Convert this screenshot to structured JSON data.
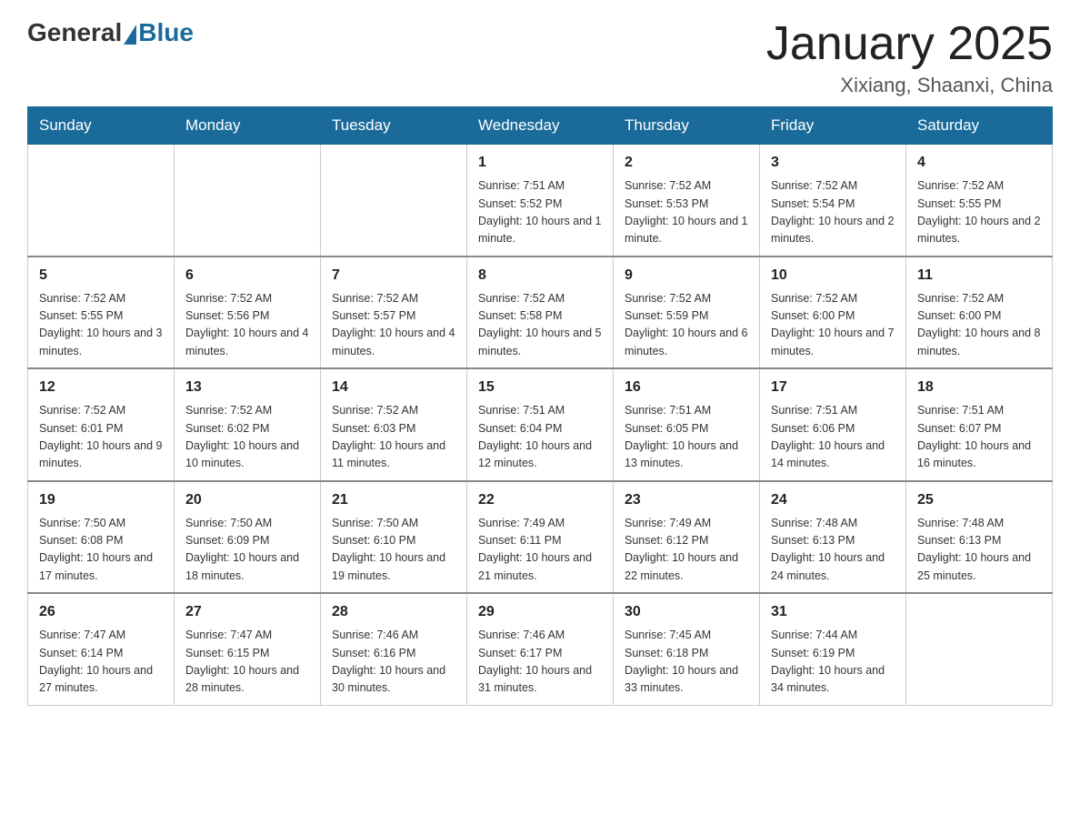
{
  "header": {
    "logo_general": "General",
    "logo_blue": "Blue",
    "title": "January 2025",
    "subtitle": "Xixiang, Shaanxi, China"
  },
  "weekdays": [
    "Sunday",
    "Monday",
    "Tuesday",
    "Wednesday",
    "Thursday",
    "Friday",
    "Saturday"
  ],
  "weeks": [
    [
      {
        "day": "",
        "sunrise": "",
        "sunset": "",
        "daylight": ""
      },
      {
        "day": "",
        "sunrise": "",
        "sunset": "",
        "daylight": ""
      },
      {
        "day": "",
        "sunrise": "",
        "sunset": "",
        "daylight": ""
      },
      {
        "day": "1",
        "sunrise": "Sunrise: 7:51 AM",
        "sunset": "Sunset: 5:52 PM",
        "daylight": "Daylight: 10 hours and 1 minute."
      },
      {
        "day": "2",
        "sunrise": "Sunrise: 7:52 AM",
        "sunset": "Sunset: 5:53 PM",
        "daylight": "Daylight: 10 hours and 1 minute."
      },
      {
        "day": "3",
        "sunrise": "Sunrise: 7:52 AM",
        "sunset": "Sunset: 5:54 PM",
        "daylight": "Daylight: 10 hours and 2 minutes."
      },
      {
        "day": "4",
        "sunrise": "Sunrise: 7:52 AM",
        "sunset": "Sunset: 5:55 PM",
        "daylight": "Daylight: 10 hours and 2 minutes."
      }
    ],
    [
      {
        "day": "5",
        "sunrise": "Sunrise: 7:52 AM",
        "sunset": "Sunset: 5:55 PM",
        "daylight": "Daylight: 10 hours and 3 minutes."
      },
      {
        "day": "6",
        "sunrise": "Sunrise: 7:52 AM",
        "sunset": "Sunset: 5:56 PM",
        "daylight": "Daylight: 10 hours and 4 minutes."
      },
      {
        "day": "7",
        "sunrise": "Sunrise: 7:52 AM",
        "sunset": "Sunset: 5:57 PM",
        "daylight": "Daylight: 10 hours and 4 minutes."
      },
      {
        "day": "8",
        "sunrise": "Sunrise: 7:52 AM",
        "sunset": "Sunset: 5:58 PM",
        "daylight": "Daylight: 10 hours and 5 minutes."
      },
      {
        "day": "9",
        "sunrise": "Sunrise: 7:52 AM",
        "sunset": "Sunset: 5:59 PM",
        "daylight": "Daylight: 10 hours and 6 minutes."
      },
      {
        "day": "10",
        "sunrise": "Sunrise: 7:52 AM",
        "sunset": "Sunset: 6:00 PM",
        "daylight": "Daylight: 10 hours and 7 minutes."
      },
      {
        "day": "11",
        "sunrise": "Sunrise: 7:52 AM",
        "sunset": "Sunset: 6:00 PM",
        "daylight": "Daylight: 10 hours and 8 minutes."
      }
    ],
    [
      {
        "day": "12",
        "sunrise": "Sunrise: 7:52 AM",
        "sunset": "Sunset: 6:01 PM",
        "daylight": "Daylight: 10 hours and 9 minutes."
      },
      {
        "day": "13",
        "sunrise": "Sunrise: 7:52 AM",
        "sunset": "Sunset: 6:02 PM",
        "daylight": "Daylight: 10 hours and 10 minutes."
      },
      {
        "day": "14",
        "sunrise": "Sunrise: 7:52 AM",
        "sunset": "Sunset: 6:03 PM",
        "daylight": "Daylight: 10 hours and 11 minutes."
      },
      {
        "day": "15",
        "sunrise": "Sunrise: 7:51 AM",
        "sunset": "Sunset: 6:04 PM",
        "daylight": "Daylight: 10 hours and 12 minutes."
      },
      {
        "day": "16",
        "sunrise": "Sunrise: 7:51 AM",
        "sunset": "Sunset: 6:05 PM",
        "daylight": "Daylight: 10 hours and 13 minutes."
      },
      {
        "day": "17",
        "sunrise": "Sunrise: 7:51 AM",
        "sunset": "Sunset: 6:06 PM",
        "daylight": "Daylight: 10 hours and 14 minutes."
      },
      {
        "day": "18",
        "sunrise": "Sunrise: 7:51 AM",
        "sunset": "Sunset: 6:07 PM",
        "daylight": "Daylight: 10 hours and 16 minutes."
      }
    ],
    [
      {
        "day": "19",
        "sunrise": "Sunrise: 7:50 AM",
        "sunset": "Sunset: 6:08 PM",
        "daylight": "Daylight: 10 hours and 17 minutes."
      },
      {
        "day": "20",
        "sunrise": "Sunrise: 7:50 AM",
        "sunset": "Sunset: 6:09 PM",
        "daylight": "Daylight: 10 hours and 18 minutes."
      },
      {
        "day": "21",
        "sunrise": "Sunrise: 7:50 AM",
        "sunset": "Sunset: 6:10 PM",
        "daylight": "Daylight: 10 hours and 19 minutes."
      },
      {
        "day": "22",
        "sunrise": "Sunrise: 7:49 AM",
        "sunset": "Sunset: 6:11 PM",
        "daylight": "Daylight: 10 hours and 21 minutes."
      },
      {
        "day": "23",
        "sunrise": "Sunrise: 7:49 AM",
        "sunset": "Sunset: 6:12 PM",
        "daylight": "Daylight: 10 hours and 22 minutes."
      },
      {
        "day": "24",
        "sunrise": "Sunrise: 7:48 AM",
        "sunset": "Sunset: 6:13 PM",
        "daylight": "Daylight: 10 hours and 24 minutes."
      },
      {
        "day": "25",
        "sunrise": "Sunrise: 7:48 AM",
        "sunset": "Sunset: 6:13 PM",
        "daylight": "Daylight: 10 hours and 25 minutes."
      }
    ],
    [
      {
        "day": "26",
        "sunrise": "Sunrise: 7:47 AM",
        "sunset": "Sunset: 6:14 PM",
        "daylight": "Daylight: 10 hours and 27 minutes."
      },
      {
        "day": "27",
        "sunrise": "Sunrise: 7:47 AM",
        "sunset": "Sunset: 6:15 PM",
        "daylight": "Daylight: 10 hours and 28 minutes."
      },
      {
        "day": "28",
        "sunrise": "Sunrise: 7:46 AM",
        "sunset": "Sunset: 6:16 PM",
        "daylight": "Daylight: 10 hours and 30 minutes."
      },
      {
        "day": "29",
        "sunrise": "Sunrise: 7:46 AM",
        "sunset": "Sunset: 6:17 PM",
        "daylight": "Daylight: 10 hours and 31 minutes."
      },
      {
        "day": "30",
        "sunrise": "Sunrise: 7:45 AM",
        "sunset": "Sunset: 6:18 PM",
        "daylight": "Daylight: 10 hours and 33 minutes."
      },
      {
        "day": "31",
        "sunrise": "Sunrise: 7:44 AM",
        "sunset": "Sunset: 6:19 PM",
        "daylight": "Daylight: 10 hours and 34 minutes."
      },
      {
        "day": "",
        "sunrise": "",
        "sunset": "",
        "daylight": ""
      }
    ]
  ]
}
